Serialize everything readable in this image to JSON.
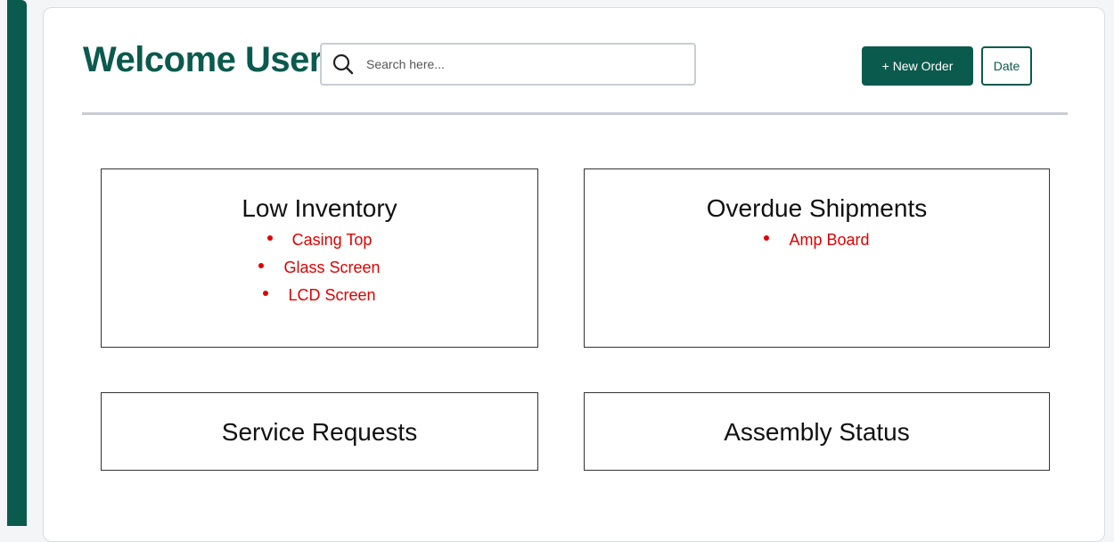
{
  "header": {
    "title": "Welcome User!",
    "search_placeholder": "Search here...",
    "new_order_label": "+ New Order",
    "date_label": "Date"
  },
  "colors": {
    "brand": "#0b5a4e",
    "alert": "#e00000"
  },
  "panels": {
    "low_inventory": {
      "title": "Low Inventory",
      "items": [
        "Casing Top",
        "Glass Screen",
        "LCD Screen"
      ]
    },
    "overdue_shipments": {
      "title": "Overdue Shipments",
      "items": [
        "Amp Board"
      ]
    },
    "service_requests": {
      "title": "Service Requests"
    },
    "assembly_status": {
      "title": "Assembly Status"
    }
  },
  "icons": {
    "search": "search-icon"
  }
}
